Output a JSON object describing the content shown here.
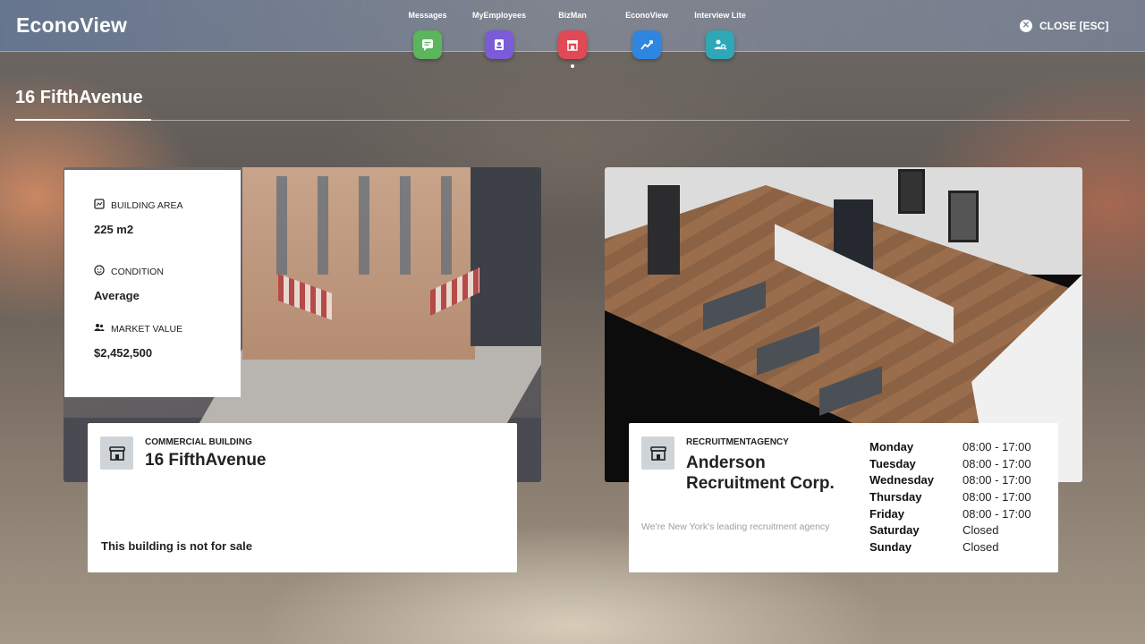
{
  "app": {
    "title": "EconoView",
    "close_label": "CLOSE [ESC]"
  },
  "apps": [
    {
      "label": "Messages",
      "icon": "chat-icon",
      "color": "#5bb55a"
    },
    {
      "label": "MyEmployees",
      "icon": "id-badge-icon",
      "color": "#7b5bd6"
    },
    {
      "label": "BizMan",
      "icon": "store-icon",
      "color": "#e04a55",
      "active": true
    },
    {
      "label": "EconoView",
      "icon": "trend-chart-icon",
      "color": "#2f86e0"
    },
    {
      "label": "Interview Lite",
      "icon": "person-search-icon",
      "color": "#2fa7b6"
    }
  ],
  "page": {
    "title": "16 FifthAvenue"
  },
  "stats": {
    "area_label": "BUILDING AREA",
    "area_value": "225 m2",
    "condition_label": "CONDITION",
    "condition_value": "Average",
    "market_label": "MARKET VALUE",
    "market_value": "$2,452,500"
  },
  "building_card": {
    "kicker": "COMMERCIAL BUILDING",
    "name": "16 FifthAvenue",
    "sale_note": "This building is not for sale"
  },
  "business_card": {
    "kicker": "RECRUITMENTAGENCY",
    "name_line1": "Anderson",
    "name_line2": "Recruitment Corp.",
    "tagline": "We're New York's leading recruitment agency",
    "hours": [
      {
        "day": "Monday",
        "time": "08:00 - 17:00"
      },
      {
        "day": "Tuesday",
        "time": "08:00 - 17:00"
      },
      {
        "day": "Wednesday",
        "time": "08:00 - 17:00"
      },
      {
        "day": "Thursday",
        "time": "08:00 - 17:00"
      },
      {
        "day": "Friday",
        "time": "08:00 - 17:00"
      },
      {
        "day": "Saturday",
        "time": "Closed"
      },
      {
        "day": "Sunday",
        "time": "Closed"
      }
    ]
  }
}
